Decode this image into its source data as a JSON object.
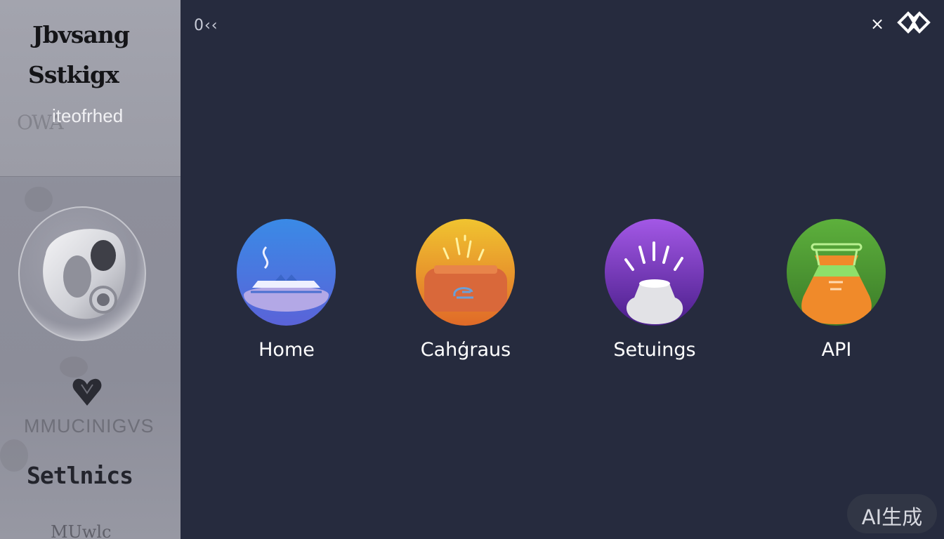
{
  "sidebar": {
    "title_line1": "Jbvsang",
    "title_line2": "Sstkigx",
    "subtitle": "iteofrhed",
    "ghost_text_1": "OWA",
    "ghost_text_2": "MMUCINIGVS",
    "label": "Setlnics",
    "bottom_text": "MUwlc"
  },
  "topbar": {
    "back_label": "0‹‹",
    "close_symbol": "×",
    "logo_icon": "chevron-logo-icon"
  },
  "apps": [
    {
      "label": "Home",
      "icon": "home-basin-icon",
      "gradient": [
        "#3a8ae6",
        "#5a63d8"
      ]
    },
    {
      "label": "Cahģraus",
      "icon": "categories-case-icon",
      "gradient": [
        "#f0c430",
        "#e06a28"
      ]
    },
    {
      "label": "Setuings",
      "icon": "settings-lamp-icon",
      "gradient": [
        "#a358e6",
        "#4a1e8a"
      ]
    },
    {
      "label": "API",
      "icon": "api-flask-icon",
      "gradient": [
        "#5db03c",
        "#3a7a28"
      ]
    }
  ],
  "watermark": "AI生成"
}
